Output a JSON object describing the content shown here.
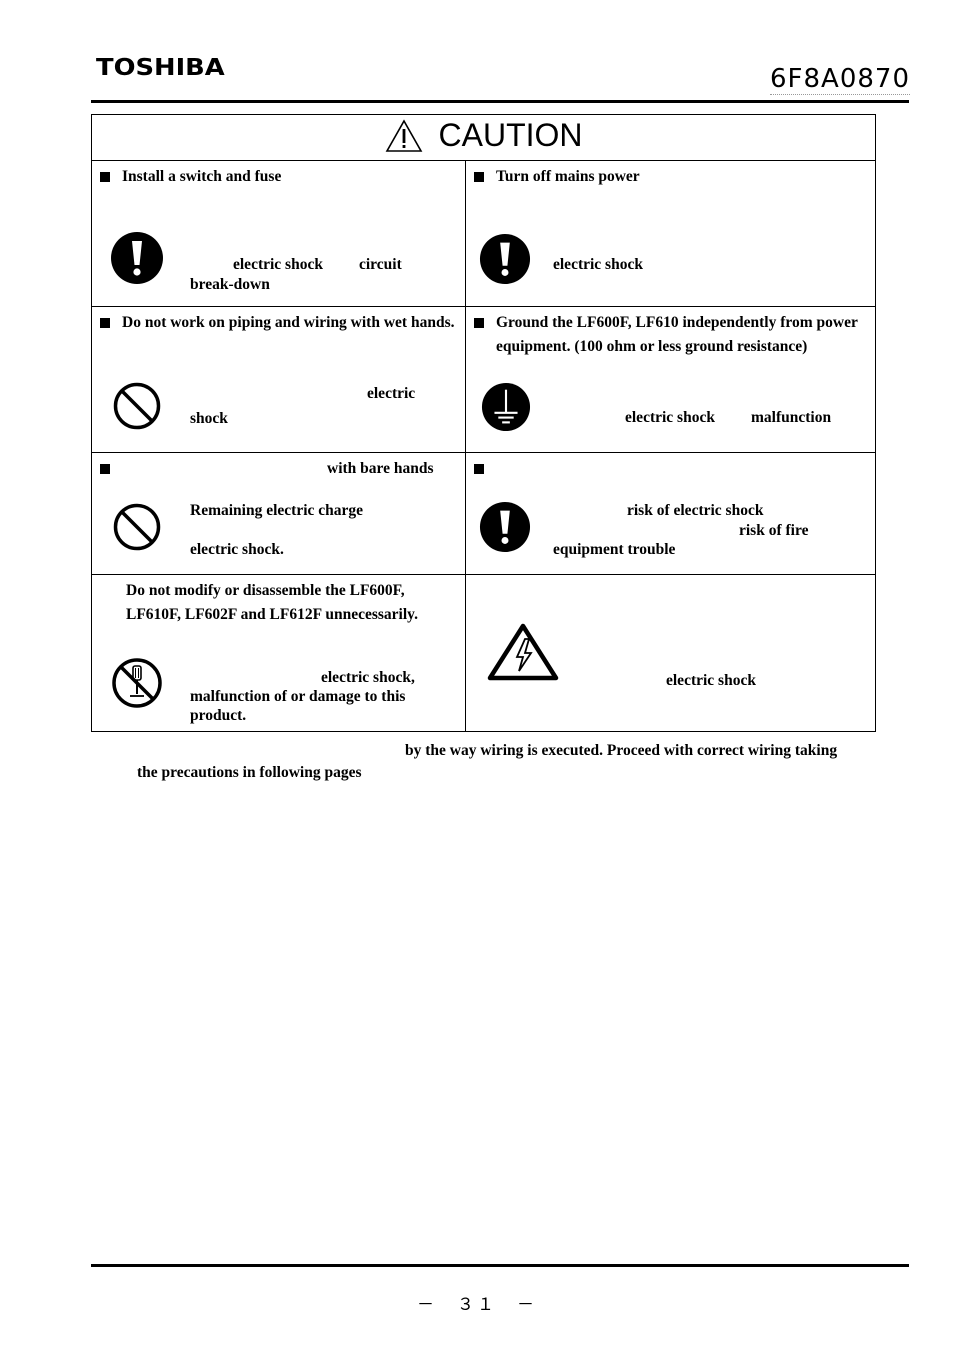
{
  "header": {
    "brand": "TOSHIBA",
    "doc_number": "6F8A0870"
  },
  "caution": {
    "title": "CAUTION",
    "cells": [
      {
        "title": "Install a switch and fuse",
        "icon": "mandatory-icon",
        "lines": [
          "electric shock",
          "circuit",
          "break-down"
        ]
      },
      {
        "title": "Turn off mains power",
        "icon": "mandatory-icon",
        "lines": [
          "electric shock"
        ]
      },
      {
        "title": "Do not work on piping and wiring with wet hands.",
        "icon": "prohibition-icon",
        "lines": [
          "electric",
          "shock"
        ]
      },
      {
        "title": "Ground the LF600F, LF610 independently from power equipment. (100 ohm or less ground resistance)",
        "icon": "ground-icon",
        "lines": [
          "electric shock",
          "malfunction"
        ]
      },
      {
        "title": "with bare hands",
        "icon": "prohibition-icon",
        "lines": [
          "Remaining electric charge",
          "electric shock."
        ]
      },
      {
        "title": "",
        "icon": "mandatory-icon",
        "lines": [
          "risk of electric shock",
          "risk of fire",
          "equipment trouble"
        ]
      },
      {
        "title": "Do not modify or disassemble the LF600F, LF610F, LF602F and LF612F unnecessarily.",
        "icon": "no-disassembly-icon",
        "lines": [
          "electric shock,",
          "malfunction of or damage to this",
          "product."
        ]
      },
      {
        "title": "",
        "icon": "high-voltage-warning-icon",
        "lines": [
          "electric shock"
        ]
      }
    ]
  },
  "note": {
    "line1": "by the way wiring is executed. Proceed with correct wiring taking",
    "line2": "the precautions in following pages"
  },
  "footer": {
    "page_number": "－　３１　－"
  }
}
